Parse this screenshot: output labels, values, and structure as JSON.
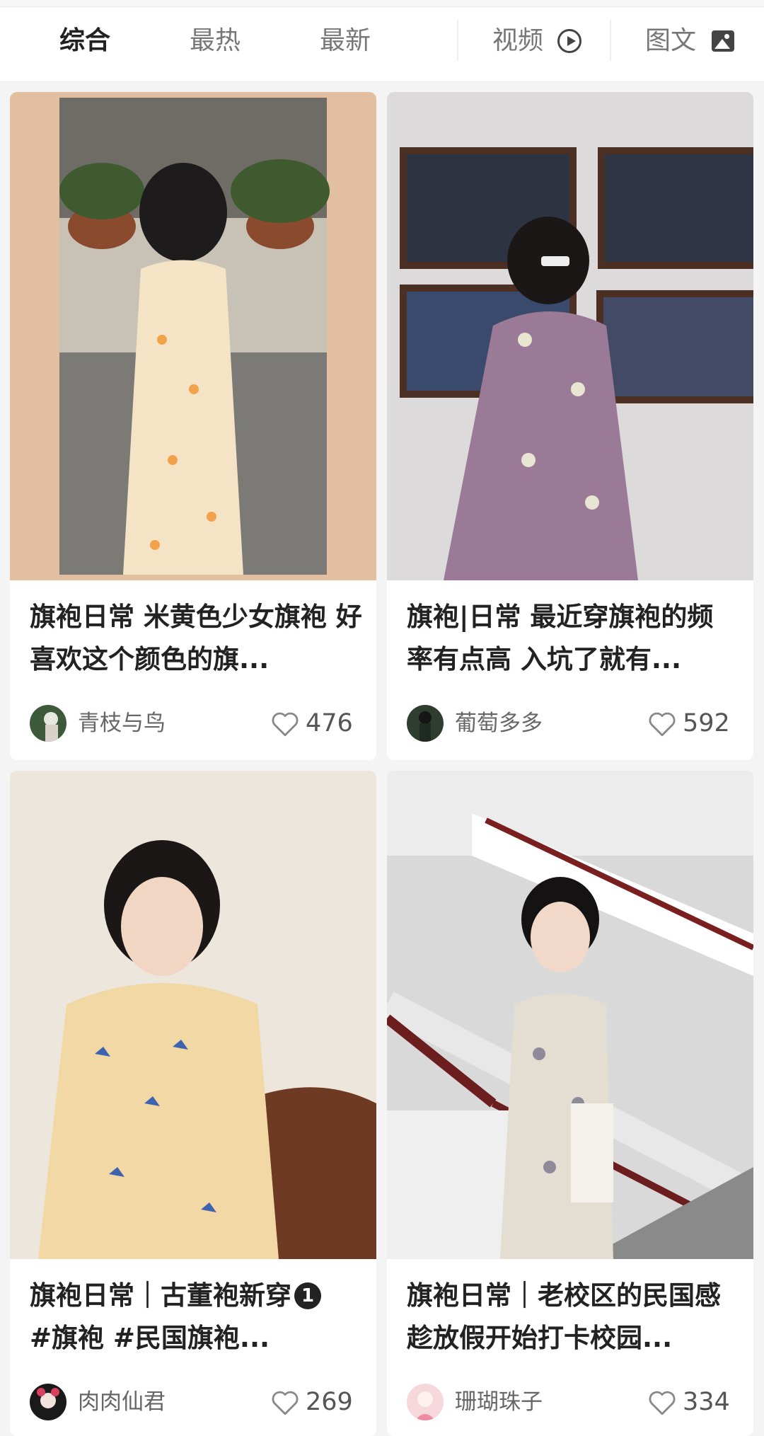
{
  "tabs": {
    "items": [
      {
        "label": "综合",
        "active": true
      },
      {
        "label": "最热",
        "active": false
      },
      {
        "label": "最新",
        "active": false
      }
    ],
    "video_label": "视频",
    "video_icon": "play-circle-icon",
    "graphic_label": "图文",
    "graphic_icon": "image-icon"
  },
  "posts": [
    {
      "title": "旗袍日常 米黄色少女旗袍 好喜欢这个颜色的旗...",
      "author": "青枝与鸟",
      "likes": "476",
      "photo_desc": "woman in cream floral qipao, back view, courtyard",
      "bg_color": "#e3bfa2"
    },
    {
      "title": "旗袍|日常 最近穿旗袍的频率有点高 入坑了就有...",
      "author": "葡萄多多",
      "likes": "592",
      "photo_desc": "woman in lavender qipao facing framed photos",
      "bg_color": "#dcdadb"
    },
    {
      "title": "旗袍日常｜古董袍新穿",
      "title_badge": "1",
      "title_line2": "#旗袍 #民国旗袍...",
      "author": "肉肉仙君",
      "likes": "269",
      "photo_desc": "woman in yellow butterfly qipao with braid",
      "bg_color": "#ece6dc"
    },
    {
      "title": "旗袍日常｜老校区的民国感 趁放假开始打卡校园...",
      "author": "珊瑚珠子",
      "likes": "334",
      "photo_desc": "woman in grey floral qipao on staircase",
      "bg_color": "#d9d9d9"
    }
  ],
  "colors": {
    "active_tab": "#222222",
    "inactive_tab": "#777777",
    "like_icon": "#888888"
  }
}
